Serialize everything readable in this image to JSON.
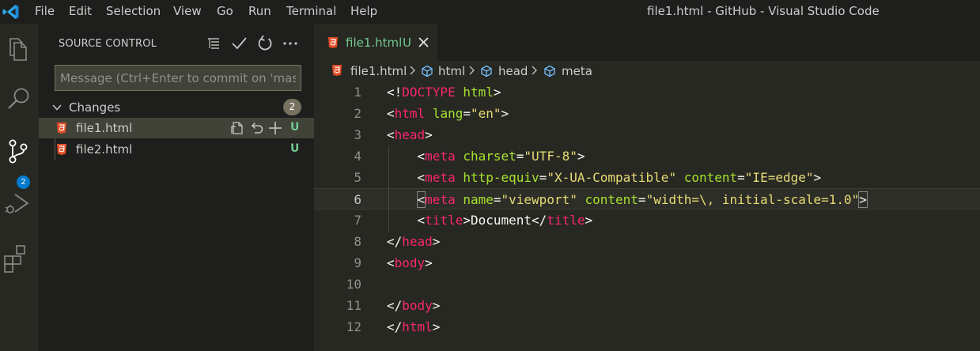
{
  "titlebar": {
    "menu": [
      "File",
      "Edit",
      "Selection",
      "View",
      "Go",
      "Run",
      "Terminal",
      "Help"
    ],
    "window_title": "file1.html - GitHub - Visual Studio Code"
  },
  "activitybar": {
    "items": [
      "explorer-icon",
      "search-icon",
      "source-control-icon",
      "run-debug-icon",
      "extensions-icon"
    ],
    "source_control_badge": "2"
  },
  "sidebar": {
    "title": "SOURCE CONTROL",
    "actions": [
      "view-as-tree-icon",
      "commit-check-icon",
      "refresh-icon",
      "more-actions-icon"
    ],
    "message_placeholder": "Message (Ctrl+Enter to commit on 'master')",
    "changes": {
      "label": "Changes",
      "count": "2",
      "files": [
        {
          "name": "file1.html",
          "status": "U",
          "selected": true
        },
        {
          "name": "file2.html",
          "status": "U",
          "selected": false
        }
      ]
    }
  },
  "editor": {
    "tab": {
      "label": "file1.html",
      "status": "U"
    },
    "breadcrumb": [
      "file1.html",
      "html",
      "head",
      "meta"
    ],
    "current_line": 6,
    "lines": [
      [
        [
          "p",
          "<!"
        ],
        [
          "tag",
          "DOCTYPE"
        ],
        [
          "p",
          " "
        ],
        [
          "attr",
          "html"
        ],
        [
          "p",
          ">"
        ]
      ],
      [
        [
          "p",
          "<"
        ],
        [
          "tag",
          "html"
        ],
        [
          "p",
          " "
        ],
        [
          "attr",
          "lang"
        ],
        [
          "p",
          "="
        ],
        [
          "str",
          "\"en\""
        ],
        [
          "p",
          ">"
        ]
      ],
      [
        [
          "p",
          "<"
        ],
        [
          "tag",
          "head"
        ],
        [
          "p",
          ">"
        ]
      ],
      [
        [
          "p",
          "    <"
        ],
        [
          "tag",
          "meta"
        ],
        [
          "p",
          " "
        ],
        [
          "attr",
          "charset"
        ],
        [
          "p",
          "="
        ],
        [
          "str",
          "\"UTF-8\""
        ],
        [
          "p",
          ">"
        ]
      ],
      [
        [
          "p",
          "    <"
        ],
        [
          "tag",
          "meta"
        ],
        [
          "p",
          " "
        ],
        [
          "attr",
          "http-equiv"
        ],
        [
          "p",
          "="
        ],
        [
          "str",
          "\"X-UA-Compatible\""
        ],
        [
          "p",
          " "
        ],
        [
          "attr",
          "content"
        ],
        [
          "p",
          "="
        ],
        [
          "str",
          "\"IE=edge\""
        ],
        [
          "p",
          ">"
        ]
      ],
      [
        [
          "p",
          "    "
        ],
        [
          "bo",
          "<"
        ],
        [
          "tag",
          "meta"
        ],
        [
          "p",
          " "
        ],
        [
          "attr",
          "name"
        ],
        [
          "p",
          "="
        ],
        [
          "str",
          "\"viewport\""
        ],
        [
          "p",
          " "
        ],
        [
          "attr",
          "content"
        ],
        [
          "p",
          "="
        ],
        [
          "str",
          "\"width=\\, initial-scale=1.0\""
        ],
        [
          "bo",
          ">"
        ]
      ],
      [
        [
          "p",
          "    <"
        ],
        [
          "tag",
          "title"
        ],
        [
          "p",
          ">"
        ],
        [
          "text",
          "Document"
        ],
        [
          "p",
          "</"
        ],
        [
          "tag",
          "title"
        ],
        [
          "p",
          ">"
        ]
      ],
      [
        [
          "p",
          "</"
        ],
        [
          "tag",
          "head"
        ],
        [
          "p",
          ">"
        ]
      ],
      [
        [
          "p",
          "<"
        ],
        [
          "tag",
          "body"
        ],
        [
          "p",
          ">"
        ]
      ],
      [],
      [
        [
          "p",
          "</"
        ],
        [
          "tag",
          "body"
        ],
        [
          "p",
          ">"
        ]
      ],
      [
        [
          "p",
          "</"
        ],
        [
          "tag",
          "html"
        ],
        [
          "p",
          ">"
        ]
      ]
    ]
  },
  "colors": {
    "accent_badge": "#007acc",
    "untracked": "#73c991",
    "tag": "#f92672",
    "attribute": "#a6e22e",
    "string": "#e6db74",
    "html_file_icon": "#e44d26"
  }
}
